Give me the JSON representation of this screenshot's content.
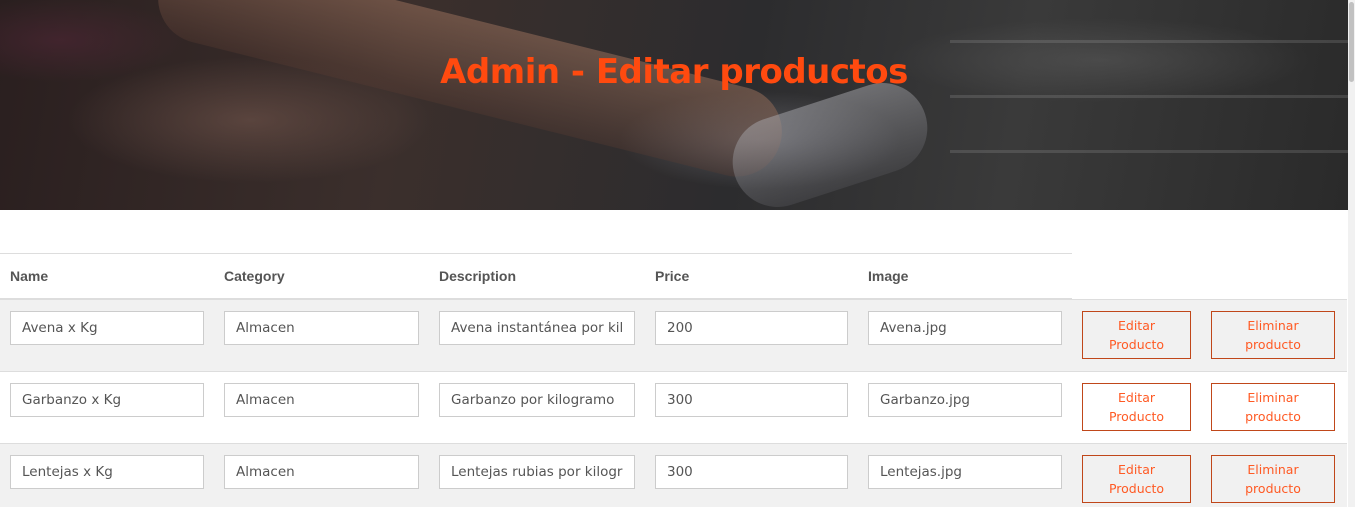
{
  "header": {
    "title": "Admin - Editar productos"
  },
  "table": {
    "columns": [
      "Name",
      "Category",
      "Description",
      "Price",
      "Image"
    ],
    "rows": [
      {
        "name": "Avena x Kg",
        "category": "Almacen",
        "description": "Avena instantánea por kilogramo",
        "price": "200",
        "image": "Avena.jpg",
        "edit_label": "Editar Producto",
        "delete_label": "Eliminar producto"
      },
      {
        "name": "Garbanzo x Kg",
        "category": "Almacen",
        "description": "Garbanzo por kilogramo",
        "price": "300",
        "image": "Garbanzo.jpg",
        "edit_label": "Editar Producto",
        "delete_label": "Eliminar producto"
      },
      {
        "name": "Lentejas x Kg",
        "category": "Almacen",
        "description": "Lentejas rubias por kilogramo",
        "price": "300",
        "image": "Lentejas.jpg",
        "edit_label": "Editar Producto",
        "delete_label": "Eliminar producto"
      }
    ]
  },
  "colors": {
    "accent": "#ff4a0f",
    "button_border": "#c0471a",
    "row_alt": "#f1f1f1"
  }
}
